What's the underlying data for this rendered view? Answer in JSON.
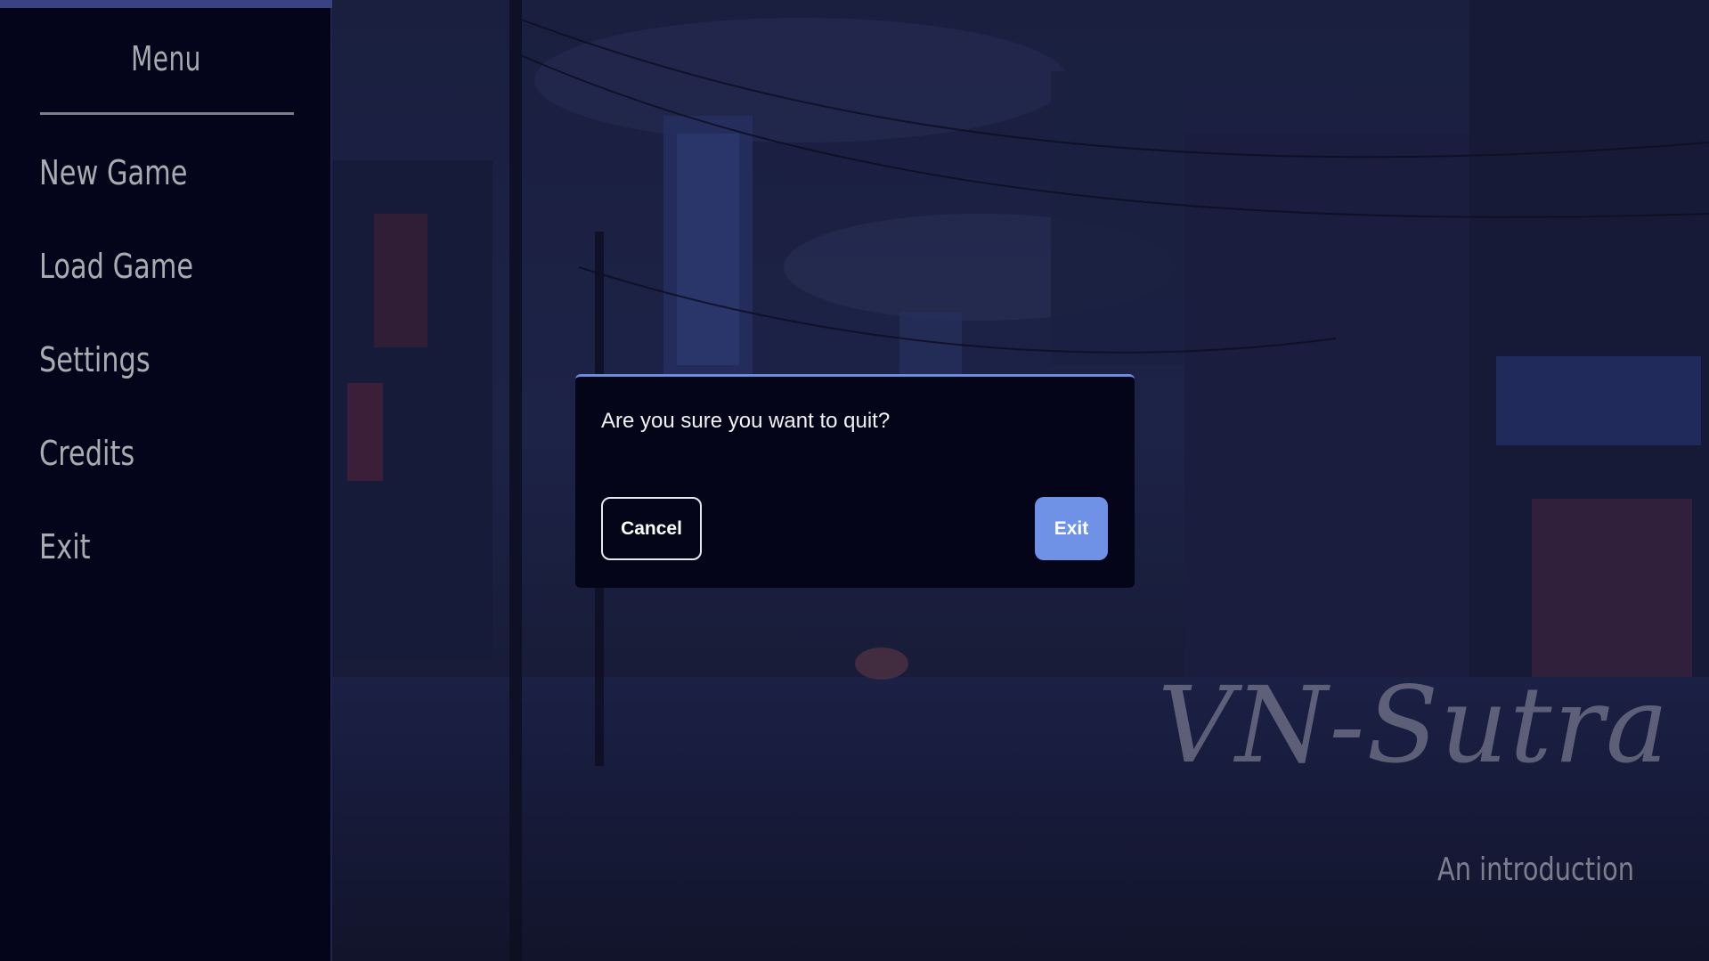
{
  "menu": {
    "title": "Menu",
    "items": [
      {
        "label": "New Game"
      },
      {
        "label": "Load Game"
      },
      {
        "label": "Settings"
      },
      {
        "label": "Credits"
      },
      {
        "label": "Exit"
      }
    ]
  },
  "title_screen": {
    "game_title": "VN-Sutra",
    "subtitle": "An introduction"
  },
  "dialog": {
    "message": "Are you sure you want to quit?",
    "cancel_label": "Cancel",
    "exit_label": "Exit"
  },
  "colors": {
    "sidebar_bg": "#04051a",
    "dialog_bg": "#05051a",
    "accent": "#6f92e6",
    "menu_text": "#a9abb0"
  }
}
